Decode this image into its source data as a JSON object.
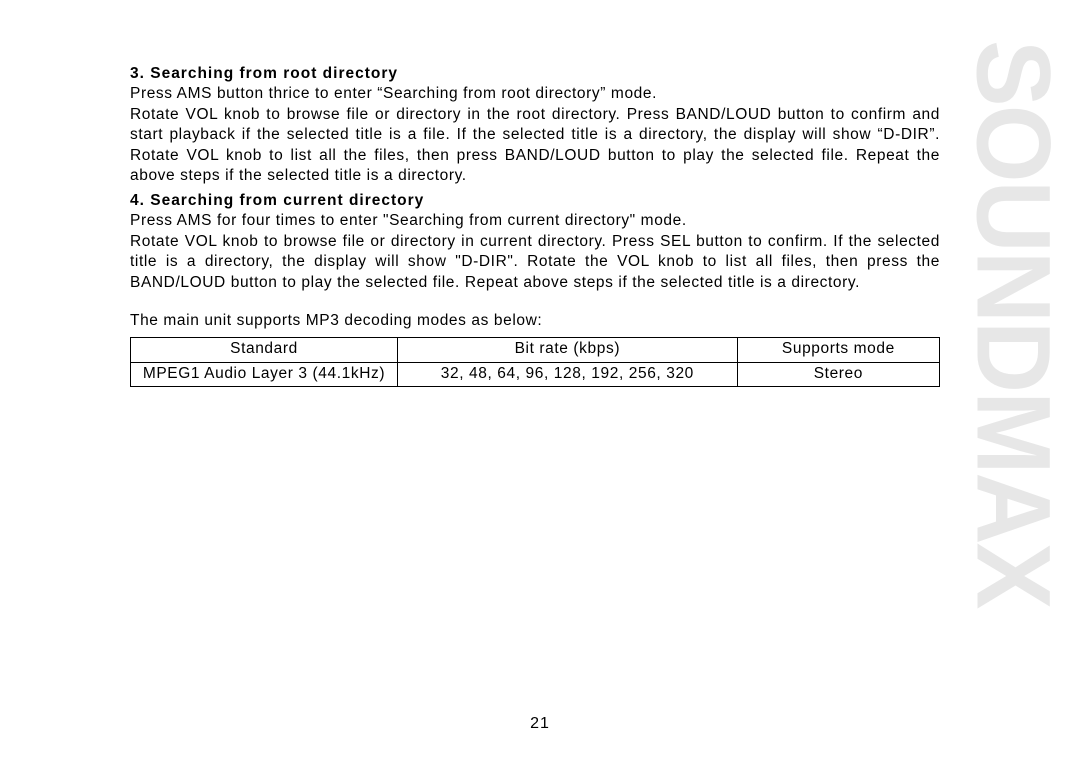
{
  "brand": "SOUNDMAX",
  "s3": {
    "heading": "3. Searching from root directory",
    "l1": "Press AMS button thrice to enter “Searching from root directory” mode.",
    "l2": "Rotate VOL knob to browse file or directory in the root directory. Press BAND/LOUD button to confirm and start playback if the selected title is a file. If the selected title is a directory, the display will show “D-DIR”. Rotate VOL knob to list all the files, then press BAND/LOUD button to play the selected file. Repeat the above steps if the selected title is a directory."
  },
  "s4": {
    "heading": "4. Searching from current directory",
    "l1": "Press AMS for four times to enter \"Searching from current directory\" mode.",
    "l2": "Rotate VOL knob to browse file or directory in current directory. Press SEL button to confirm. If the selected title is a directory, the display will show \"D-DIR\". Rotate the VOL knob to list all files, then press the BAND/LOUD button to play the selected file. Repeat above steps if the selected title is a directory."
  },
  "support_intro": "The main unit supports MP3 decoding modes as below:",
  "table": {
    "h1": "Standard",
    "h2": "Bit rate (kbps)",
    "h3": "Supports mode",
    "r1c1": "MPEG1 Audio Layer 3 (44.1kHz)",
    "r1c2": "32, 48, 64, 96, 128, 192, 256, 320",
    "r1c3": "Stereo"
  },
  "page_number": "21"
}
